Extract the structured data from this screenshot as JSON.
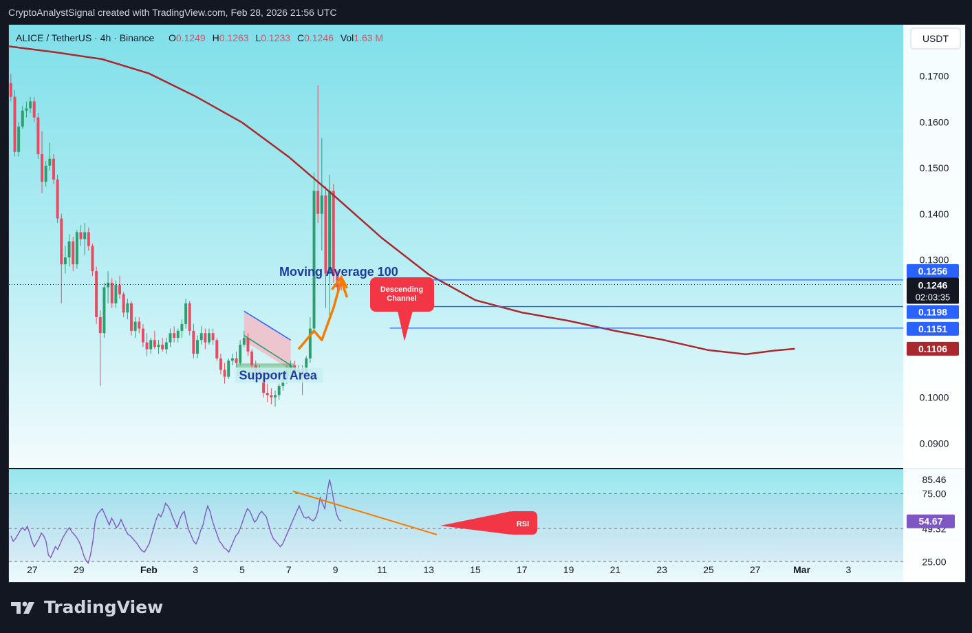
{
  "header": {
    "attribution": "CryptoAnalystSignal created with TradingView.com, Feb 28, 2026 21:56 UTC"
  },
  "footer": {
    "brand": "TradingView"
  },
  "colors": {
    "bg_top": "#7fdfe9",
    "bg_bottom": "#f4fbfd",
    "up": "#2e9e6e",
    "down": "#e84a5f",
    "ma": "#a8282e",
    "blue_level": "#2962ff",
    "orange": "#f57c00",
    "rsi_line": "#7e57c2",
    "callout": "#f23645"
  },
  "chart_data": {
    "type": "candlestick",
    "symbol_info": {
      "pair": "ALICE / TetherUS · 4h · Binance",
      "o_label": "O",
      "o": "0.1249",
      "h_label": "H",
      "h": "0.1263",
      "l_label": "L",
      "l": "0.1233",
      "c_label": "C",
      "c": "0.1246",
      "vol_label": "Vol",
      "vol": "1.63 M"
    },
    "currency": "USDT",
    "y_range": [
      0.0845,
      0.1812
    ],
    "y_ticks": [
      "0.1700",
      "0.1600",
      "0.1500",
      "0.1400",
      "0.1300",
      "0.1000",
      "0.0900"
    ],
    "x_labels": [
      "27",
      "29",
      "Feb",
      "3",
      "5",
      "7",
      "9",
      "11",
      "13",
      "15",
      "17",
      "19",
      "21",
      "23",
      "25",
      "27",
      "Mar",
      "3"
    ],
    "x_label_day_offsets": [
      1,
      3,
      6,
      8,
      10,
      12,
      14,
      16,
      18,
      20,
      22,
      24,
      26,
      28,
      30,
      32,
      34,
      36
    ],
    "current_price": "0.1246",
    "countdown": "02:03:35",
    "levels": [
      {
        "price": 0.1256,
        "label": "0.1256"
      },
      {
        "price": 0.1198,
        "label": "0.1198"
      },
      {
        "price": 0.1151,
        "label": "0.1151"
      }
    ],
    "ma_label": "0.1106",
    "ma_points": [
      [
        0,
        0.1765
      ],
      [
        2,
        0.1752
      ],
      [
        4,
        0.1737
      ],
      [
        6,
        0.1706
      ],
      [
        8,
        0.1656
      ],
      [
        10,
        0.1599
      ],
      [
        12,
        0.1524
      ],
      [
        14,
        0.1437
      ],
      [
        16,
        0.1347
      ],
      [
        18,
        0.1268
      ],
      [
        20,
        0.1212
      ],
      [
        22,
        0.1185
      ],
      [
        24,
        0.1167
      ],
      [
        26,
        0.1145
      ],
      [
        28,
        0.1126
      ],
      [
        30,
        0.1103
      ],
      [
        31.6,
        0.1094
      ],
      [
        32.8,
        0.1102
      ],
      [
        33.7,
        0.1106
      ]
    ],
    "candles": [
      [
        0.1685,
        0.1705,
        0.1645,
        0.1655
      ],
      [
        0.1655,
        0.167,
        0.1525,
        0.1535
      ],
      [
        0.1535,
        0.16,
        0.1525,
        0.159
      ],
      [
        0.159,
        0.1635,
        0.1585,
        0.1625
      ],
      [
        0.1625,
        0.1645,
        0.161,
        0.163
      ],
      [
        0.163,
        0.1655,
        0.162,
        0.1645
      ],
      [
        0.1645,
        0.1655,
        0.16,
        0.161
      ],
      [
        0.161,
        0.162,
        0.152,
        0.153
      ],
      [
        0.153,
        0.158,
        0.1445,
        0.147
      ],
      [
        0.147,
        0.1515,
        0.146,
        0.1505
      ],
      [
        0.1505,
        0.1555,
        0.1495,
        0.152
      ],
      [
        0.152,
        0.153,
        0.1465,
        0.1475
      ],
      [
        0.1475,
        0.1485,
        0.138,
        0.139
      ],
      [
        0.139,
        0.14,
        0.1205,
        0.129
      ],
      [
        0.129,
        0.133,
        0.127,
        0.1305
      ],
      [
        0.1305,
        0.1355,
        0.1285,
        0.134
      ],
      [
        0.134,
        0.135,
        0.1275,
        0.129
      ],
      [
        0.129,
        0.1365,
        0.128,
        0.136
      ],
      [
        0.136,
        0.1375,
        0.133,
        0.1345
      ],
      [
        0.1345,
        0.138,
        0.131,
        0.136
      ],
      [
        0.136,
        0.137,
        0.132,
        0.133
      ],
      [
        0.133,
        0.1335,
        0.1265,
        0.1275
      ],
      [
        0.1275,
        0.1285,
        0.116,
        0.1175
      ],
      [
        0.1175,
        0.119,
        0.1025,
        0.114
      ],
      [
        0.114,
        0.125,
        0.113,
        0.124
      ],
      [
        0.124,
        0.1275,
        0.1205,
        0.125
      ],
      [
        0.125,
        0.126,
        0.1195,
        0.1205
      ],
      [
        0.1205,
        0.1255,
        0.1195,
        0.1245
      ],
      [
        0.1245,
        0.1265,
        0.1215,
        0.1225
      ],
      [
        0.1225,
        0.123,
        0.1175,
        0.1185
      ],
      [
        0.1185,
        0.1215,
        0.117,
        0.1205
      ],
      [
        0.1205,
        0.121,
        0.1135,
        0.1145
      ],
      [
        0.1145,
        0.1175,
        0.113,
        0.1165
      ],
      [
        0.1165,
        0.1175,
        0.114,
        0.115
      ],
      [
        0.115,
        0.116,
        0.111,
        0.112
      ],
      [
        0.112,
        0.114,
        0.109,
        0.1105
      ],
      [
        0.1105,
        0.113,
        0.1095,
        0.1125
      ],
      [
        0.1125,
        0.1145,
        0.1105,
        0.111
      ],
      [
        0.111,
        0.1125,
        0.1095,
        0.1115
      ],
      [
        0.1115,
        0.113,
        0.11,
        0.1105
      ],
      [
        0.1105,
        0.113,
        0.1095,
        0.112
      ],
      [
        0.112,
        0.115,
        0.111,
        0.114
      ],
      [
        0.114,
        0.1155,
        0.112,
        0.113
      ],
      [
        0.113,
        0.115,
        0.112,
        0.1145
      ],
      [
        0.1145,
        0.117,
        0.113,
        0.116
      ],
      [
        0.116,
        0.1215,
        0.115,
        0.1205
      ],
      [
        0.1205,
        0.121,
        0.1135,
        0.1145
      ],
      [
        0.1145,
        0.116,
        0.1085,
        0.1095
      ],
      [
        0.1095,
        0.1135,
        0.1085,
        0.1125
      ],
      [
        0.1125,
        0.1155,
        0.1115,
        0.114
      ],
      [
        0.114,
        0.115,
        0.1105,
        0.112
      ],
      [
        0.112,
        0.115,
        0.1115,
        0.114
      ],
      [
        0.114,
        0.115,
        0.1115,
        0.1125
      ],
      [
        0.1125,
        0.113,
        0.108,
        0.1085
      ],
      [
        0.1085,
        0.1095,
        0.105,
        0.106
      ],
      [
        0.106,
        0.1075,
        0.103,
        0.1045
      ],
      [
        0.1045,
        0.1085,
        0.104,
        0.108
      ],
      [
        0.108,
        0.1095,
        0.107,
        0.1085
      ],
      [
        0.1085,
        0.11,
        0.1065,
        0.1075
      ],
      [
        0.1075,
        0.1125,
        0.107,
        0.1115
      ],
      [
        0.1115,
        0.1145,
        0.111,
        0.113
      ],
      [
        0.113,
        0.114,
        0.109,
        0.11
      ],
      [
        0.11,
        0.1105,
        0.106,
        0.107
      ],
      [
        0.107,
        0.108,
        0.105,
        0.106
      ],
      [
        0.106,
        0.107,
        0.104,
        0.105
      ],
      [
        0.105,
        0.1055,
        0.1,
        0.101
      ],
      [
        0.101,
        0.103,
        0.099,
        0.1005
      ],
      [
        0.1005,
        0.102,
        0.0985,
        0.1
      ],
      [
        0.1,
        0.1015,
        0.098,
        0.1005
      ],
      [
        0.1005,
        0.103,
        0.0995,
        0.1025
      ],
      [
        0.1025,
        0.105,
        0.1015,
        0.104
      ],
      [
        0.104,
        0.107,
        0.103,
        0.106
      ],
      [
        0.106,
        0.108,
        0.105,
        0.107
      ],
      [
        0.107,
        0.108,
        0.1045,
        0.1055
      ],
      [
        0.1055,
        0.107,
        0.1045,
        0.106
      ],
      [
        0.106,
        0.107,
        0.1005,
        0.105
      ],
      [
        0.105,
        0.109,
        0.1045,
        0.1085
      ],
      [
        0.1085,
        0.1175,
        0.1075,
        0.115
      ],
      [
        0.115,
        0.149,
        0.114,
        0.145
      ],
      [
        0.145,
        0.168,
        0.138,
        0.14
      ],
      [
        0.14,
        0.1565,
        0.132,
        0.144
      ],
      [
        0.144,
        0.146,
        0.1195,
        0.127
      ],
      [
        0.127,
        0.1485,
        0.117,
        0.145
      ],
      [
        0.145,
        0.1465,
        0.125,
        0.1265
      ],
      [
        0.1265,
        0.1275,
        0.123,
        0.124
      ],
      [
        0.1249,
        0.1263,
        0.1233,
        0.1246
      ]
    ],
    "rsi": {
      "label": "RSI",
      "current": "54.67",
      "range": [
        15,
        92
      ],
      "bands": [
        75,
        49.32,
        25
      ],
      "band_labels": [
        "85.46",
        "75.00",
        "49.32",
        "25.00"
      ],
      "values": [
        44,
        40,
        42,
        45,
        48,
        50,
        48,
        51,
        46,
        40,
        36,
        39,
        42,
        46,
        44,
        40,
        30,
        28,
        32,
        36,
        34,
        38,
        42,
        45,
        48,
        50,
        47,
        45,
        43,
        40,
        36,
        30,
        26,
        24,
        30,
        40,
        55,
        60,
        62,
        64,
        60,
        56,
        52,
        57,
        54,
        50,
        52,
        56,
        52,
        48,
        45,
        44,
        42,
        40,
        38,
        35,
        33,
        32,
        35,
        38,
        44,
        50,
        56,
        60,
        58,
        62,
        68,
        66,
        63,
        58,
        54,
        50,
        56,
        60,
        62,
        54,
        48,
        44,
        40,
        38,
        42,
        48,
        52,
        60,
        66,
        62,
        55,
        50,
        45,
        40,
        38,
        35,
        34,
        32,
        36,
        40,
        44,
        46,
        50,
        55,
        60,
        64,
        62,
        58,
        54,
        56,
        60,
        62,
        60,
        58,
        52,
        46,
        42,
        40,
        38,
        36,
        38,
        42,
        46,
        50,
        54,
        58,
        62,
        66,
        62,
        58,
        57,
        58,
        56,
        55,
        57,
        62,
        72,
        68,
        64,
        76,
        85.5,
        78,
        68,
        60,
        56,
        54.7
      ]
    },
    "annotations": {
      "ma_title": "Moving Average 100",
      "descending_channel": "Descending\nChannel",
      "support_area": "Support Area",
      "rsi_tag": "RSI"
    }
  }
}
